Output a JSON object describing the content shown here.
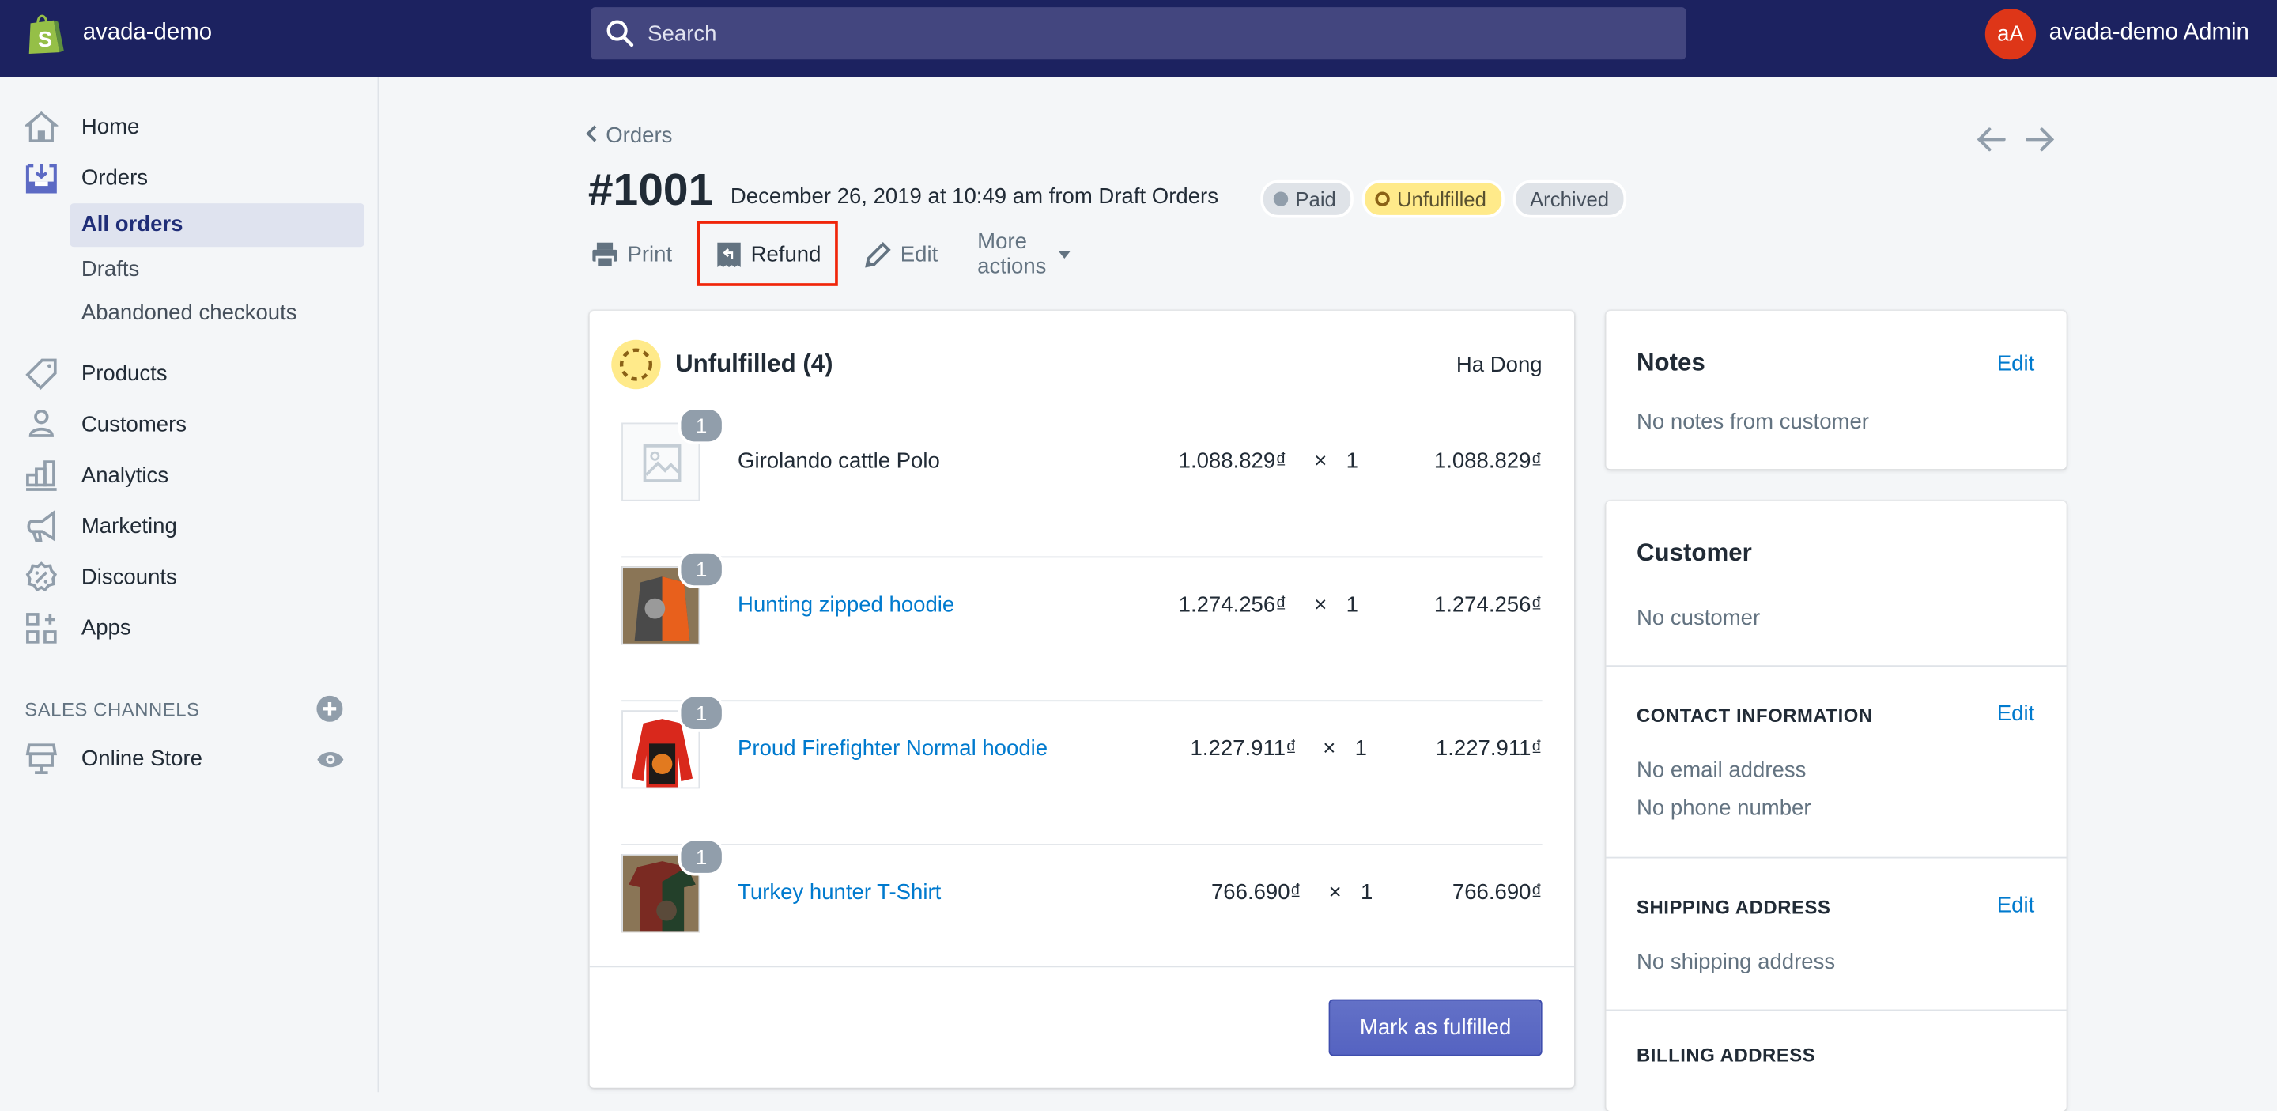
{
  "topbar": {
    "store_name": "avada-demo",
    "search_placeholder": "Search",
    "avatar_initials": "aA",
    "user_name": "avada-demo Admin"
  },
  "sidebar": {
    "items": [
      {
        "label": "Home",
        "icon": "home-icon"
      },
      {
        "label": "Orders",
        "icon": "orders-icon"
      },
      {
        "label": "Products",
        "icon": "tag-icon"
      },
      {
        "label": "Customers",
        "icon": "person-icon"
      },
      {
        "label": "Analytics",
        "icon": "bar-chart-icon"
      },
      {
        "label": "Marketing",
        "icon": "megaphone-icon"
      },
      {
        "label": "Discounts",
        "icon": "discount-icon"
      },
      {
        "label": "Apps",
        "icon": "apps-icon"
      }
    ],
    "orders_sub": [
      {
        "label": "All orders",
        "active": true
      },
      {
        "label": "Drafts",
        "active": false
      },
      {
        "label": "Abandoned checkouts",
        "active": false
      }
    ],
    "sales_channels_label": "SALES CHANNELS",
    "channels": [
      {
        "label": "Online Store",
        "icon": "store-icon"
      }
    ]
  },
  "page": {
    "breadcrumb": "Orders",
    "order_number": "#1001",
    "meta": "December 26, 2019 at 10:49 am from Draft Orders",
    "badges": {
      "paid": "Paid",
      "unfulfilled": "Unfulfilled",
      "archived": "Archived"
    },
    "actions": {
      "print": "Print",
      "refund": "Refund",
      "edit": "Edit",
      "more": "More actions"
    }
  },
  "fulfillment": {
    "title": "Unfulfilled (4)",
    "location": "Ha Dong",
    "items": [
      {
        "name": "Girolando cattle Polo",
        "link": false,
        "price": "1.088.829₫",
        "times": "×",
        "qty": "1",
        "total": "1.088.829₫",
        "badge": "1"
      },
      {
        "name": "Hunting zipped hoodie",
        "link": true,
        "price": "1.274.256₫",
        "times": "×",
        "qty": "1",
        "total": "1.274.256₫",
        "badge": "1"
      },
      {
        "name": "Proud Firefighter Normal hoodie",
        "link": true,
        "price": "1.227.911₫",
        "times": "×",
        "qty": "1",
        "total": "1.227.911₫",
        "badge": "1"
      },
      {
        "name": "Turkey hunter T-Shirt",
        "link": true,
        "price": "766.690₫",
        "times": "×",
        "qty": "1",
        "total": "766.690₫",
        "badge": "1"
      }
    ],
    "button": "Mark as fulfilled"
  },
  "notes": {
    "title": "Notes",
    "edit": "Edit",
    "body": "No notes from customer"
  },
  "customer": {
    "title": "Customer",
    "body": "No customer",
    "contact_title": "CONTACT INFORMATION",
    "contact_edit": "Edit",
    "email": "No email address",
    "phone": "No phone number",
    "shipping_title": "SHIPPING ADDRESS",
    "shipping_edit": "Edit",
    "shipping_body": "No shipping address",
    "billing_title": "BILLING ADDRESS"
  },
  "colors": {
    "topbar": "#1c2260",
    "accent": "#5c6ac4",
    "link": "#007ace",
    "highlight": "#f0250a"
  }
}
